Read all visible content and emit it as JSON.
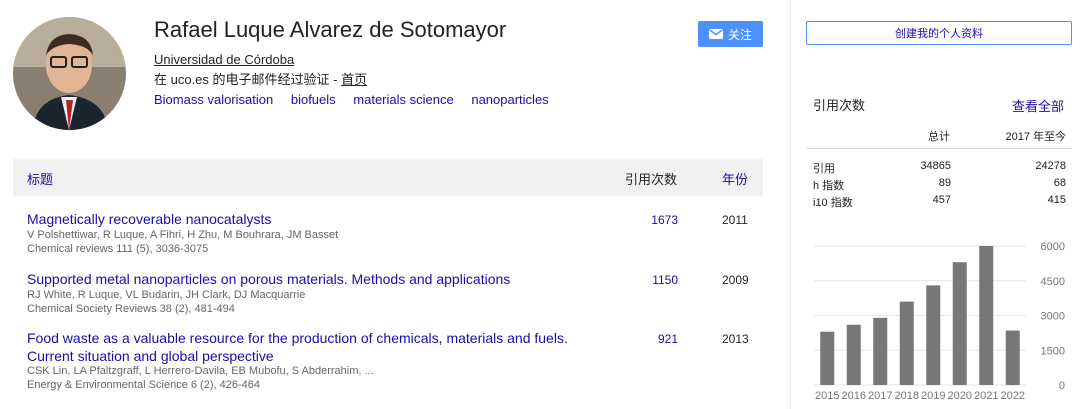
{
  "profile": {
    "name": "Rafael Luque Alvarez de Sotomayor",
    "affiliation": "Universidad de Córdoba",
    "email_prefix": "在 uco.es 的电子邮件经过验证 - ",
    "homepage": "首页",
    "interests": [
      "Biomass valorisation",
      "biofuels",
      "materials science",
      "nanoparticles"
    ],
    "follow_label": "关注"
  },
  "table": {
    "header": {
      "title": "标题",
      "cited_by": "引用次数",
      "year": "年份"
    },
    "articles": [
      {
        "title": "Magnetically recoverable nanocatalysts",
        "authors": "V Polshettiwar, R Luque, A Fihri, H Zhu, M Bouhrara, JM Basset",
        "venue": "Chemical reviews 111 (5), 3036-3075",
        "cites": "1673",
        "year": "2011"
      },
      {
        "title": "Supported metal nanoparticles on porous materials. Methods and applications",
        "authors": "RJ White, R Luque, VL Budarin, JH Clark, DJ Macquarrie",
        "venue": "Chemical Society Reviews 38 (2), 481-494",
        "cites": "1150",
        "year": "2009"
      },
      {
        "title": "Food waste as a valuable resource for the production of chemicals, materials and fuels. Current situation and global perspective",
        "authors": "CSK Lin, LA Pfaltzgraff, L Herrero-Davila, EB Mubofu, S Abderrahim, ...",
        "venue": "Energy & Environmental Science 6 (2), 426-464",
        "cites": "921",
        "year": "2013"
      }
    ]
  },
  "sidebar": {
    "create_profile_label": "创建我的个人资料",
    "cited_by_heading": "引用次数",
    "view_all": "查看全部",
    "stats": {
      "col_all": "总计",
      "col_since": "2017 年至今",
      "rows": [
        {
          "label": "引用",
          "all": "34865",
          "since": "24278"
        },
        {
          "label": "h 指数",
          "all": "89",
          "since": "68"
        },
        {
          "label": "i10 指数",
          "all": "457",
          "since": "415"
        }
      ]
    }
  },
  "chart_data": {
    "type": "bar",
    "categories": [
      "2015",
      "2016",
      "2017",
      "2018",
      "2019",
      "2020",
      "2021",
      "2022"
    ],
    "values": [
      2300,
      2600,
      2900,
      3600,
      4300,
      5300,
      6000,
      2350
    ],
    "ylim": [
      0,
      6000
    ],
    "yticks": [
      0,
      1500,
      3000,
      4500,
      6000
    ],
    "bar_color": "#777777"
  },
  "colors": {
    "link": "#1a0dab",
    "accent": "#4d90fe"
  }
}
